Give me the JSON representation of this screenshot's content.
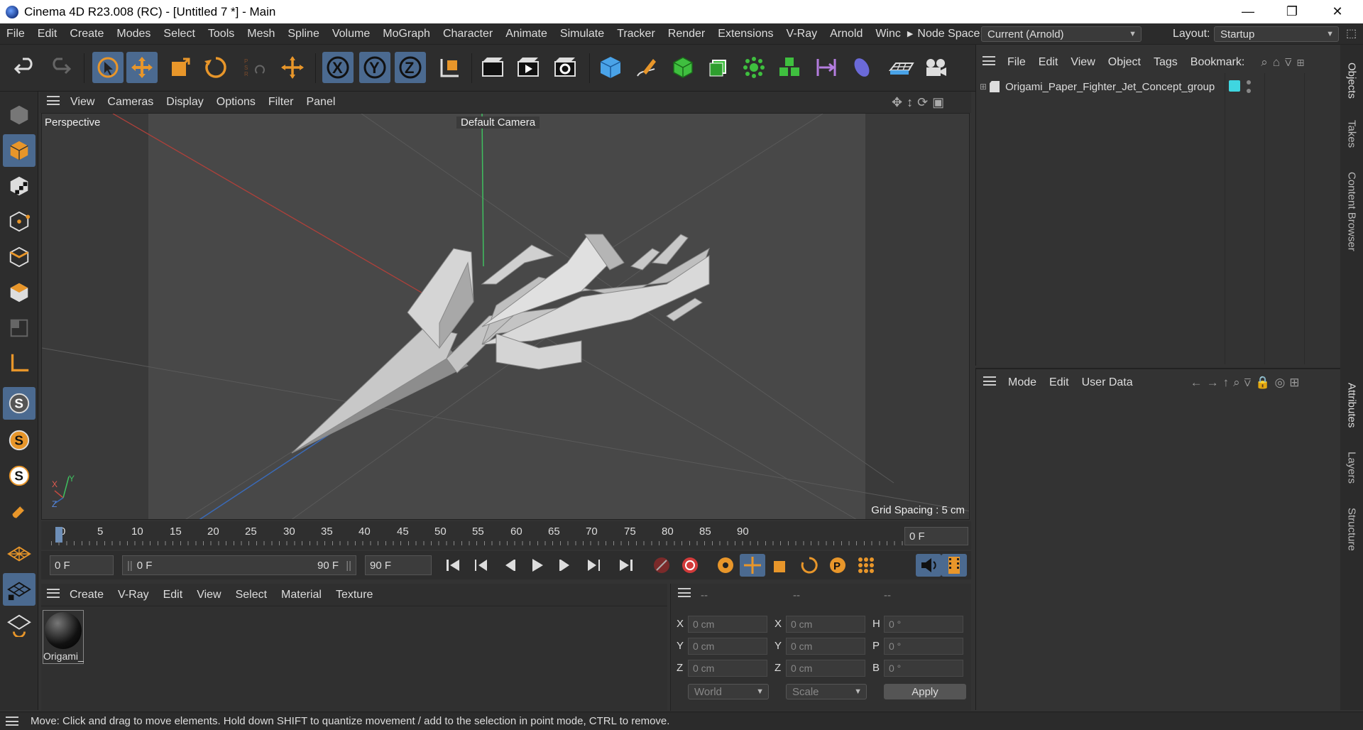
{
  "window": {
    "title": "Cinema 4D R23.008 (RC) - [Untitled 7 *] - Main",
    "minimize": "—",
    "maximize": "❐",
    "close": "✕"
  },
  "menubar": {
    "items": [
      "File",
      "Edit",
      "Create",
      "Modes",
      "Select",
      "Tools",
      "Mesh",
      "Spline",
      "Volume",
      "MoGraph",
      "Character",
      "Animate",
      "Simulate",
      "Tracker",
      "Render",
      "Extensions",
      "V-Ray",
      "Arnold",
      "Winc"
    ],
    "node_space_label": "Node Space:",
    "node_space_value": "Current (Arnold)",
    "layout_label": "Layout:",
    "layout_value": "Startup"
  },
  "viewport": {
    "menu": [
      "View",
      "Cameras",
      "Display",
      "Options",
      "Filter",
      "Panel"
    ],
    "view_name": "Perspective",
    "camera": "Default Camera",
    "grid_spacing": "Grid Spacing : 5 cm",
    "axis_x": "X",
    "axis_y": "Y",
    "axis_z": "Z"
  },
  "timeline": {
    "ticks": [
      "0",
      "5",
      "10",
      "15",
      "20",
      "25",
      "30",
      "35",
      "40",
      "45",
      "50",
      "55",
      "60",
      "65",
      "70",
      "75",
      "80",
      "85",
      "90"
    ],
    "current_frame": "0 F"
  },
  "transport": {
    "start_field": "0 F",
    "range_start": "0 F",
    "range_end": "90 F",
    "end_field": "90 F"
  },
  "materials": {
    "menu": [
      "Create",
      "V-Ray",
      "Edit",
      "View",
      "Select",
      "Material",
      "Texture"
    ],
    "items": [
      {
        "name": "Origami_"
      }
    ]
  },
  "coords": {
    "headers": [
      "--",
      "--",
      "--"
    ],
    "rows": [
      {
        "a": "X",
        "av": "0 cm",
        "b": "X",
        "bv": "0 cm",
        "c": "H",
        "cv": "0 °"
      },
      {
        "a": "Y",
        "av": "0 cm",
        "b": "Y",
        "bv": "0 cm",
        "c": "P",
        "cv": "0 °"
      },
      {
        "a": "Z",
        "av": "0 cm",
        "b": "Z",
        "bv": "0 cm",
        "c": "B",
        "cv": "0 °"
      }
    ],
    "world": "World",
    "scale": "Scale",
    "apply": "Apply"
  },
  "objects": {
    "menu": [
      "File",
      "Edit",
      "View",
      "Object",
      "Tags",
      "Bookmark:"
    ],
    "items": [
      {
        "name": "Origami_Paper_Fighter_Jet_Concept_group",
        "color": "#3fd6e0"
      }
    ]
  },
  "attributes": {
    "menu": [
      "Mode",
      "Edit",
      "User Data"
    ]
  },
  "sidetabs": {
    "top": [
      "Objects",
      "Takes",
      "Content Browser"
    ],
    "bottom": [
      "Attributes",
      "Layers",
      "Structure"
    ]
  },
  "status": "Move: Click and drag to move elements. Hold down SHIFT to quantize movement / add to the selection in point mode, CTRL to remove.",
  "colors": {
    "accent": "#e8962a",
    "selection": "#4b6a90",
    "panel": "#333333"
  }
}
